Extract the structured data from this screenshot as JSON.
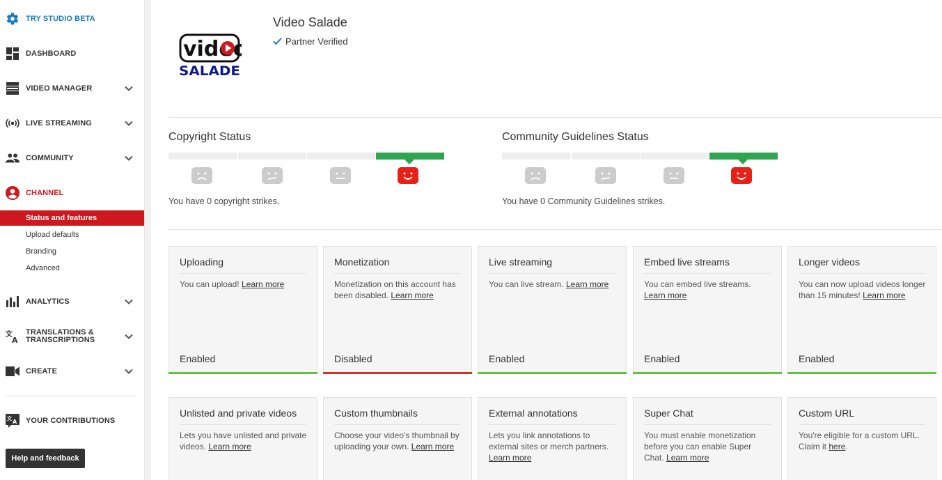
{
  "sidebar": {
    "studio_beta": "TRY STUDIO BETA",
    "items": [
      {
        "label": "DASHBOARD"
      },
      {
        "label": "VIDEO MANAGER"
      },
      {
        "label": "LIVE STREAMING"
      },
      {
        "label": "COMMUNITY"
      },
      {
        "label": "CHANNEL"
      },
      {
        "label": "ANALYTICS"
      },
      {
        "label": "TRANSLATIONS &"
      },
      {
        "label": "TRANSCRIPTIONS"
      },
      {
        "label": "CREATE"
      },
      {
        "label": "YOUR CONTRIBUTIONS"
      }
    ],
    "channel_sub": [
      "Status and features",
      "Upload defaults",
      "Branding",
      "Advanced"
    ],
    "help_button": "Help and feedback"
  },
  "channel": {
    "name": "Video Salade",
    "partner_status": "Partner Verified",
    "logo_text_top": "video",
    "logo_text_bottom": "SALADE"
  },
  "copyright": {
    "title": "Copyright Status",
    "text": "You have 0 copyright strikes.",
    "strikes": 0
  },
  "community": {
    "title": "Community Guidelines Status",
    "text": "You have 0 Community Guidelines strikes.",
    "strikes": 0
  },
  "learn_more": "Learn more",
  "features": [
    {
      "title": "Uploading",
      "desc": "You can upload!",
      "state": "Enabled"
    },
    {
      "title": "Monetization",
      "desc": "Monetization on this account has been disabled.",
      "state": "Disabled"
    },
    {
      "title": "Live streaming",
      "desc": "You can live stream.",
      "state": "Enabled"
    },
    {
      "title": "Embed live streams",
      "desc": "You can embed live streams.",
      "state": "Enabled"
    },
    {
      "title": "Longer videos",
      "desc": "You can now upload videos longer than 15 minutes!",
      "state": "Enabled"
    },
    {
      "title": "Unlisted and private videos",
      "desc": "Lets you have unlisted and private videos."
    },
    {
      "title": "Custom thumbnails",
      "desc": "Choose your video's thumbnail by uploading your own."
    },
    {
      "title": "External annotations",
      "desc": "Lets you link annotations to external sites or merch partners."
    },
    {
      "title": "Super Chat",
      "desc": "You must enable monetization before you can enable Super Chat."
    },
    {
      "title": "Custom URL",
      "desc": "You're eligible for a custom URL. Claim it",
      "link": "here"
    }
  ],
  "colors": {
    "accent_red": "#cc181e",
    "studio_blue": "#167ac6",
    "enabled_green": "#5ec63a",
    "disabled_red": "#d93025"
  }
}
